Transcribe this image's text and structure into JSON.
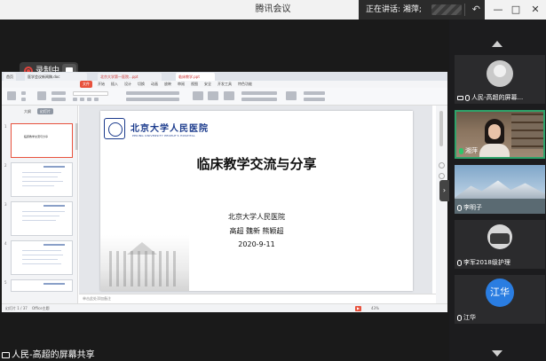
{
  "titlebar": {
    "app_title": "腾讯会议",
    "speaking": "正在讲话: 湘萍;",
    "minimize": "—",
    "maximize": "□",
    "close": "✕"
  },
  "recording": {
    "label": "录制中"
  },
  "wps": {
    "tabs": [
      "首页",
      "医学会议新闻稿.doc",
      "北京大学第一医院...ppt",
      "临床教学.ppt"
    ],
    "menu": [
      "文件",
      "开始",
      "插入",
      "设计",
      "切换",
      "动画",
      "放映",
      "审阅",
      "视图",
      "安全",
      "开发工具",
      "特色功能"
    ],
    "panel_tabs": [
      "大纲",
      "幻灯片"
    ],
    "notes_placeholder": "单击此处添加备注",
    "status_left": "幻灯片 1 / 37",
    "status_right": "Office主题",
    "zoom": "43%",
    "play": "▶"
  },
  "slide": {
    "hospital_cn": "北京大学人民医院",
    "hospital_en": "PEKING UNIVERSITY PEOPLE'S HOSPITAL",
    "title": "临床教学交流与分享",
    "org": "北京大学人民医院",
    "authors": "高超  魏新  熊颖超",
    "date": "2020-9-11"
  },
  "thumbs": [
    {
      "num": "1",
      "text": "临床教学交流与分享"
    },
    {
      "num": "2",
      "text": ""
    },
    {
      "num": "3",
      "text": ""
    },
    {
      "num": "4",
      "text": ""
    },
    {
      "num": "5",
      "text": ""
    }
  ],
  "share_label": "人民-高超的屏幕共享",
  "participants": [
    {
      "name": "人民-高超的屏幕..."
    },
    {
      "name": "湘萍"
    },
    {
      "name": "李明子"
    },
    {
      "name": "李军2018级护理"
    },
    {
      "name": "江华",
      "initials": "江华"
    }
  ]
}
